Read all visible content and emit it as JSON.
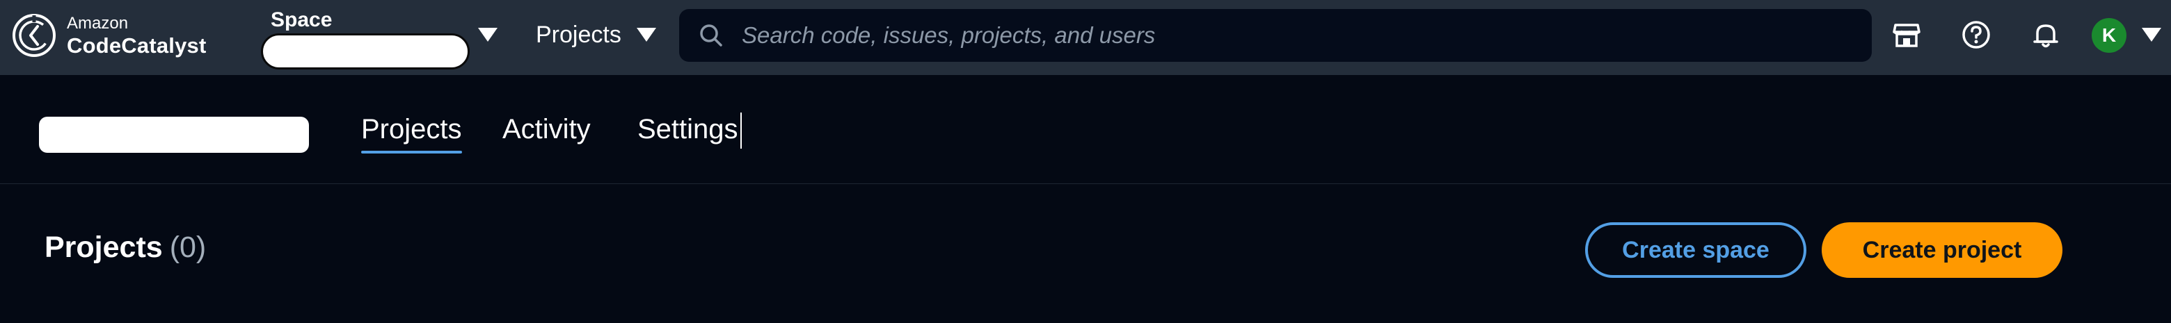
{
  "brand": {
    "company": "Amazon",
    "product": "CodeCatalyst"
  },
  "topbar": {
    "space_label": "Space",
    "space_value": "",
    "projects_label": "Projects",
    "search_placeholder": "Search code, issues, projects, and users",
    "avatar_initial": "K",
    "avatar_color": "#1a8a2e",
    "icons": [
      "marketplace-icon",
      "help-icon",
      "notifications-icon"
    ]
  },
  "subnav": {
    "space_name": "",
    "tabs": [
      {
        "label": "Projects",
        "active": true
      },
      {
        "label": "Activity",
        "active": false
      },
      {
        "label": "Settings",
        "active": false
      }
    ]
  },
  "content": {
    "heading": "Projects",
    "count": "(0)",
    "create_space_label": "Create space",
    "create_project_label": "Create project"
  },
  "colors": {
    "topbar_bg": "#242e3b",
    "page_bg": "#040914",
    "accent_blue": "#539fe5",
    "primary_orange": "#ff9900"
  }
}
